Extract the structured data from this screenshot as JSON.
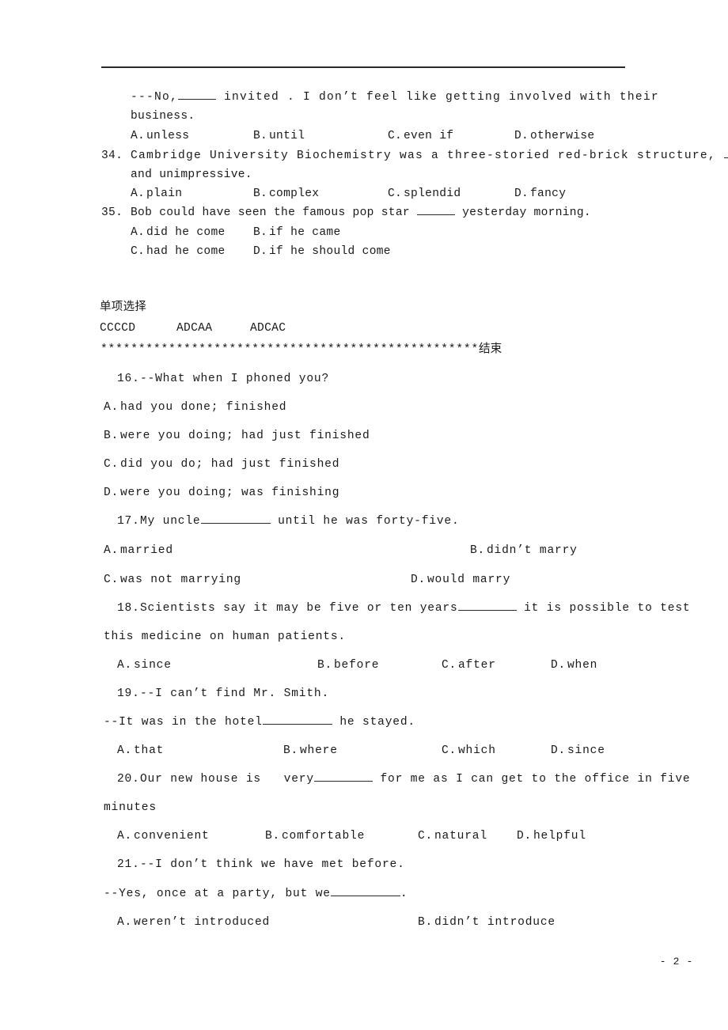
{
  "page": {
    "number_label": "- 2 -",
    "divider": true
  },
  "top_block": {
    "q33_tail": {
      "line1_before": "---No,",
      "line1_after": "invited . I don’t feel like getting involved with their",
      "line2": "business.",
      "options": [
        {
          "letter": "A.",
          "text": "unless"
        },
        {
          "letter": "B.",
          "text": "until"
        },
        {
          "letter": "C.",
          "text": "even if"
        },
        {
          "letter": "D.",
          "text": "otherwise"
        }
      ]
    },
    "questions": [
      {
        "number": "34.",
        "stem_line1": "Cambridge University Biochemistry was a three-storied red-brick structure,",
        "stem_line2": "and unimpressive.",
        "options": [
          {
            "letter": "A.",
            "text": "plain"
          },
          {
            "letter": "B.",
            "text": "complex"
          },
          {
            "letter": "C.",
            "text": "splendid"
          },
          {
            "letter": "D.",
            "text": "fancy"
          }
        ]
      },
      {
        "number": "35.",
        "stem_before": "Bob could have seen the famous pop star",
        "stem_after": "yesterday morning.",
        "options_row1": [
          {
            "letter": "A.",
            "text": "did he come"
          },
          {
            "letter": "B.",
            "text": "if he came"
          }
        ],
        "options_row2": [
          {
            "letter": "C.",
            "text": "had he come"
          },
          {
            "letter": "D.",
            "text": "if he should come"
          }
        ]
      }
    ]
  },
  "answer_key": {
    "heading": "单项选择",
    "answers": [
      "CCCCD",
      "ADCAA",
      "ADCAC"
    ],
    "separator_stars": "**************************************************",
    "separator_end_label": "结束"
  },
  "lower_block": {
    "questions": [
      {
        "number": "16.",
        "stem": "--What when I phoned you?",
        "options": [
          {
            "letter": "A.",
            "text": "had you done; finished"
          },
          {
            "letter": "B.",
            "text": "were you doing; had just finished"
          },
          {
            "letter": "C.",
            "text": "did you do; had just finished"
          },
          {
            "letter": "D.",
            "text": "were you doing; was finishing"
          }
        ]
      },
      {
        "number": "17.",
        "stem_before": "My uncle",
        "stem_after": "until he was forty-five.",
        "options": [
          {
            "letter": "A.",
            "text": "married"
          },
          {
            "letter": "B.",
            "text": "didn’t marry"
          },
          {
            "letter": "C.",
            "text": "was not marrying"
          },
          {
            "letter": "D.",
            "text": "would marry"
          }
        ]
      },
      {
        "number": "18.",
        "stem_before": "Scientists say it may be five or ten years",
        "stem_after": "it is possible to test",
        "stem_line2": "this medicine on human patients.",
        "options": [
          {
            "letter": "A.",
            "text": "since"
          },
          {
            "letter": "B.",
            "text": "before"
          },
          {
            "letter": "C.",
            "text": "after"
          },
          {
            "letter": "D.",
            "text": "when"
          }
        ]
      },
      {
        "number": "19.",
        "stem": "--I can’t find Mr. Smith.",
        "reply_before": "--It was in the hotel",
        "reply_after": "he stayed.",
        "options": [
          {
            "letter": "A.",
            "text": "that"
          },
          {
            "letter": "B.",
            "text": "where"
          },
          {
            "letter": "C.",
            "text": "which"
          },
          {
            "letter": "D.",
            "text": "since"
          }
        ]
      },
      {
        "number": "20.",
        "stem_before": "Our new house is   very",
        "stem_after": "for me as I can get to the office in five",
        "stem_line2": "minutes",
        "options": [
          {
            "letter": "A.",
            "text": "convenient"
          },
          {
            "letter": "B.",
            "text": "comfortable"
          },
          {
            "letter": "C.",
            "text": "natural"
          },
          {
            "letter": "D.",
            "text": "helpful"
          }
        ]
      },
      {
        "number": "21.",
        "stem": "--I don’t think we have met before.",
        "reply_before": "--Yes, once at a party, but we",
        "reply_after": ".",
        "options": [
          {
            "letter": "A.",
            "text": "weren’t introduced"
          },
          {
            "letter": "B.",
            "text": "didn’t introduce"
          }
        ]
      }
    ]
  }
}
